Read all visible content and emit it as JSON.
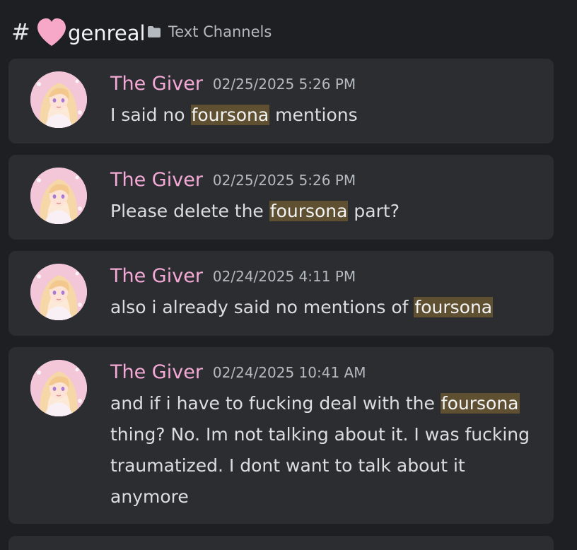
{
  "header": {
    "hash_symbol": "#",
    "channel_name": "genreal",
    "category_label": "Text Channels",
    "heart_color": "#f7a8c8"
  },
  "messages": [
    {
      "author": "The Giver",
      "timestamp": "02/25/2025 5:26 PM",
      "parts": [
        {
          "text": "I said no ",
          "highlight": false
        },
        {
          "text": "foursona",
          "highlight": true
        },
        {
          "text": " mentions",
          "highlight": false
        }
      ]
    },
    {
      "author": "The Giver",
      "timestamp": "02/25/2025 5:26 PM",
      "parts": [
        {
          "text": "Please delete the ",
          "highlight": false
        },
        {
          "text": "foursona",
          "highlight": true
        },
        {
          "text": " part?",
          "highlight": false
        }
      ]
    },
    {
      "author": "The Giver",
      "timestamp": "02/24/2025 4:11 PM",
      "parts": [
        {
          "text": "also i already said no mentions of ",
          "highlight": false
        },
        {
          "text": "foursona",
          "highlight": true
        }
      ]
    },
    {
      "author": "The Giver",
      "timestamp": "02/24/2025 10:41 AM",
      "parts": [
        {
          "text": "and if i have to fucking deal with the ",
          "highlight": false
        },
        {
          "text": "foursona",
          "highlight": true
        },
        {
          "text": " thing? No. Im not talking about it. I was fucking traumatized. I dont want to talk about it anymore",
          "highlight": false
        }
      ]
    }
  ],
  "colors": {
    "background": "#1e1f22",
    "card": "#2b2d31",
    "author": "#f5a9d6",
    "highlight": "#5f5031"
  }
}
